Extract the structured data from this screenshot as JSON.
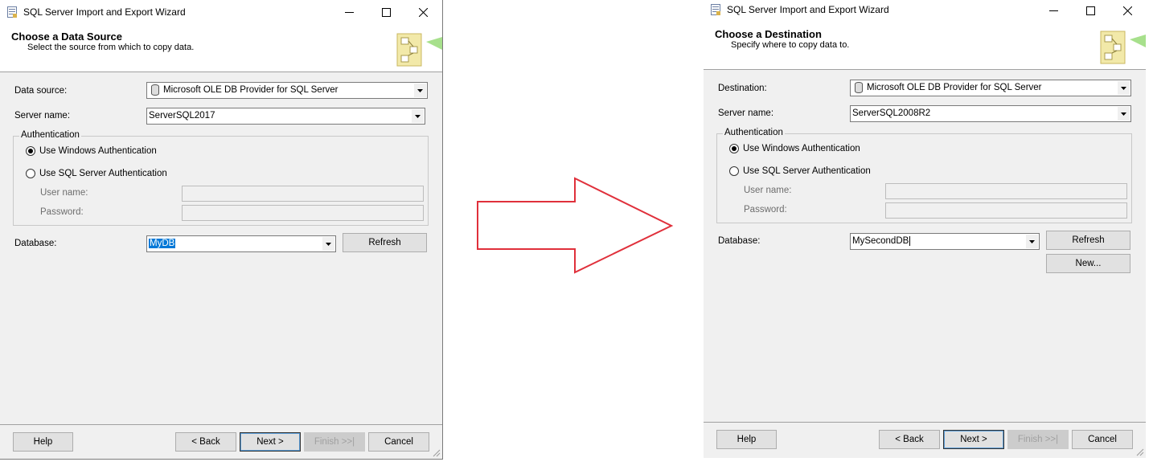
{
  "colors": {
    "arrow_stroke": "#e0303b",
    "selection": "#0078d7",
    "window_bg": "#f0f0f0"
  },
  "left_window": {
    "title": "SQL Server Import and Export Wizard",
    "page_title": "Choose a Data Source",
    "page_subtitle": "Select the source from which to copy data.",
    "data_source_label": "Data source:",
    "data_source_value": "Microsoft OLE DB Provider for SQL Server",
    "server_name_label": "Server name:",
    "server_name_value": "ServerSQL2017",
    "auth_group_label": "Authentication",
    "windows_auth_label": "Use Windows Authentication",
    "sql_auth_label": "Use SQL Server Authentication",
    "user_name_label": "User name:",
    "password_label": "Password:",
    "database_label": "Database:",
    "database_value": "MyDB",
    "refresh_button": "Refresh",
    "help_button": "Help",
    "back_button": "< Back",
    "next_button": "Next >",
    "finish_button": "Finish >>|",
    "cancel_button": "Cancel"
  },
  "right_window": {
    "title": "SQL Server Import and Export Wizard",
    "page_title": "Choose a Destination",
    "page_subtitle": "Specify where to copy data to.",
    "destination_label": "Destination:",
    "destination_value": "Microsoft OLE DB Provider for SQL Server",
    "server_name_label": "Server name:",
    "server_name_value": "ServerSQL2008R2",
    "auth_group_label": "Authentication",
    "windows_auth_label": "Use Windows Authentication",
    "sql_auth_label": "Use SQL Server Authentication",
    "user_name_label": "User name:",
    "password_label": "Password:",
    "database_label": "Database:",
    "database_value": "MySecondDB",
    "refresh_button": "Refresh",
    "new_button": "New...",
    "help_button": "Help",
    "back_button": "< Back",
    "next_button": "Next >",
    "finish_button": "Finish >>|",
    "cancel_button": "Cancel"
  },
  "icons": {
    "app": "wizard-app-icon",
    "minimize": "minimize-icon",
    "maximize": "maximize-icon",
    "close": "close-icon",
    "database": "database-icon",
    "dropdown": "chevron-down-icon",
    "header_art": "wizard-header-art",
    "arrow": "right-arrow-icon"
  }
}
